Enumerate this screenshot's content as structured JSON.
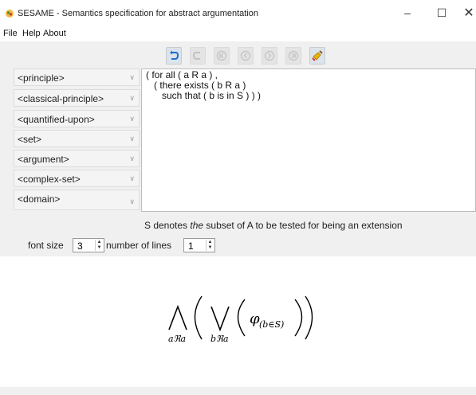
{
  "window": {
    "title": "SESAME - Semantics specification for abstract argumentation",
    "minimize_glyph": "–",
    "maximize_glyph": "☐",
    "close_glyph": "✕"
  },
  "menu": {
    "file": "File",
    "help": "Help",
    "about": "About"
  },
  "toolbar": {
    "icons": [
      "undo-icon",
      "redo-icon",
      "first-icon",
      "previous-icon",
      "next-icon",
      "last-icon",
      "clean-icon"
    ],
    "enabled": [
      true,
      false,
      false,
      false,
      false,
      false,
      true
    ]
  },
  "sidebar": {
    "items": [
      {
        "label": "<principle>"
      },
      {
        "label": "<classical-principle>"
      },
      {
        "label": "<quantified-upon>"
      },
      {
        "label": "<set>"
      },
      {
        "label": "<argument>"
      },
      {
        "label": "<complex-set>"
      },
      {
        "label": "<domain>"
      }
    ]
  },
  "editor": {
    "text": "( for all ( a R a ) ,\n   ( there exists ( b R a )\n      such that ( b is in S ) ) )"
  },
  "note": {
    "prefix": "S denotes ",
    "emph": "the",
    "suffix": " subset of A to be tested for being an extension"
  },
  "controls": {
    "font_size_label": "font size",
    "font_size_value": "3",
    "lines_label": "number of lines",
    "lines_value": "1"
  },
  "formula": {
    "outer_sub": "aℜa",
    "inner_sub": "bℜa",
    "phi": "φ",
    "phi_sub": "(b∈S)"
  },
  "colors": {
    "panel": "#f0f0f0",
    "undo_blue": "#1a6fd1",
    "clean_yellow": "#e8b400"
  }
}
